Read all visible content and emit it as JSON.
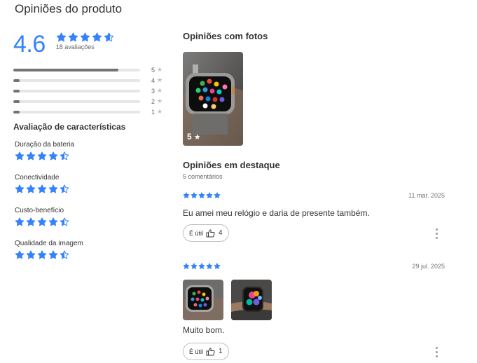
{
  "page_title": "Opiniões do produto",
  "rating": {
    "score": "4.6",
    "count_text": "18 avaliações",
    "stars": 4.6,
    "distribution": [
      {
        "label": "5",
        "fraction": 0.83
      },
      {
        "label": "4",
        "fraction": 0.05
      },
      {
        "label": "3",
        "fraction": 0.05
      },
      {
        "label": "2",
        "fraction": 0.05
      },
      {
        "label": "1",
        "fraction": 0.05
      }
    ]
  },
  "features": {
    "title": "Avaliação de características",
    "items": [
      {
        "label": "Duração da bateria",
        "stars": 4.5
      },
      {
        "label": "Conectividade",
        "stars": 4.5
      },
      {
        "label": "Custo-benefício",
        "stars": 4.5
      },
      {
        "label": "Qualidade da imagem",
        "stars": 4.5
      }
    ]
  },
  "photos": {
    "title": "Opiniões com fotos",
    "main_photo_rating": "5"
  },
  "featured": {
    "title": "Opiniões em destaque",
    "subtitle": "5 comentários",
    "reviews": [
      {
        "stars": 5,
        "date": "11 mar. 2025",
        "text": "Eu amei meu relógio e daria de presente também.",
        "useful_label": "É útil",
        "useful_count": "4"
      },
      {
        "stars": 5,
        "date": "29 jul. 2025",
        "text": "Muito bom.",
        "useful_label": "É útil",
        "useful_count": "1"
      }
    ]
  },
  "colors": {
    "accent": "#3483fa",
    "bar_fill": "#737373",
    "bar_bg": "#e6e6e6"
  }
}
